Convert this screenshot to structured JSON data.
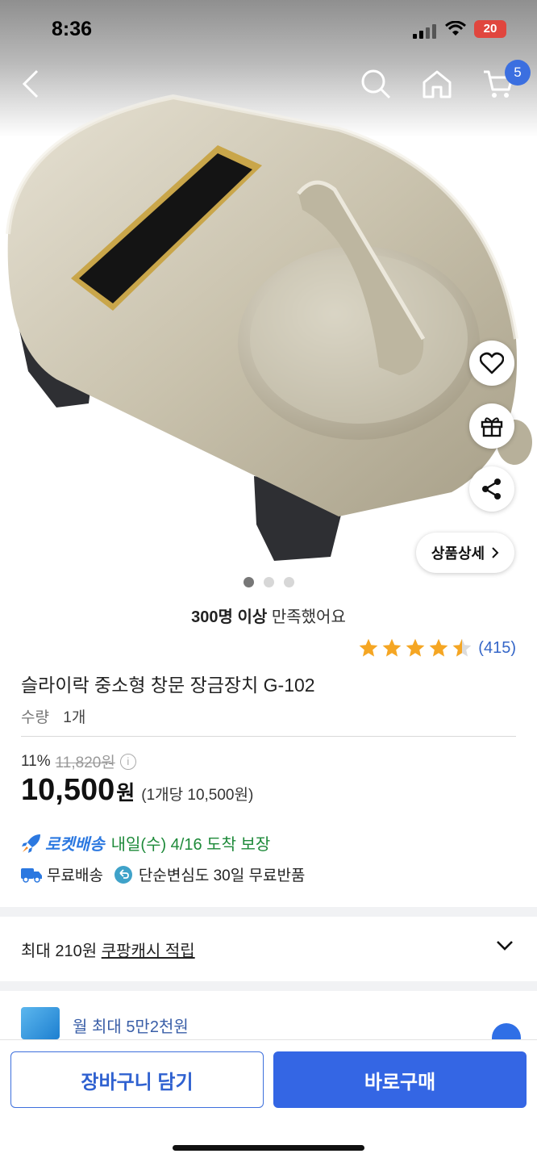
{
  "status_bar": {
    "time": "8:36",
    "battery": "20"
  },
  "nav": {
    "cart_count": "5"
  },
  "product": {
    "badge_text": "슬라이락",
    "detail_button": "상품상세",
    "satisfied_bold": "300명 이상",
    "satisfied_rest": "만족했어요",
    "rating": 4.5,
    "review_count": "(415)",
    "title": "슬라이락 중소형 창문 장금장치 G-102",
    "quantity_label": "수량",
    "quantity_value": "1개",
    "discount": "11%",
    "original_price": "11,820원",
    "price": "10,500",
    "price_unit": "원",
    "unit_price": "(1개당 10,500원)"
  },
  "delivery": {
    "rocket_brand": "로켓배송",
    "rocket_eta": "내일(수) 4/16 도착 보장",
    "free_shipping": "무료배송",
    "free_return": "단순변심도 30일 무료반품"
  },
  "cash": {
    "prefix": "최대 210원",
    "link": "쿠팡캐시 적립"
  },
  "card_promo": {
    "text": "월 최대 5만2천원"
  },
  "bottom": {
    "cart_button": "장바구니 담기",
    "buy_button": "바로구매"
  },
  "colors": {
    "accent": "#3466e4",
    "star": "#f5a623",
    "rocket": "#2b78e0",
    "eta": "#1e8a3a"
  }
}
